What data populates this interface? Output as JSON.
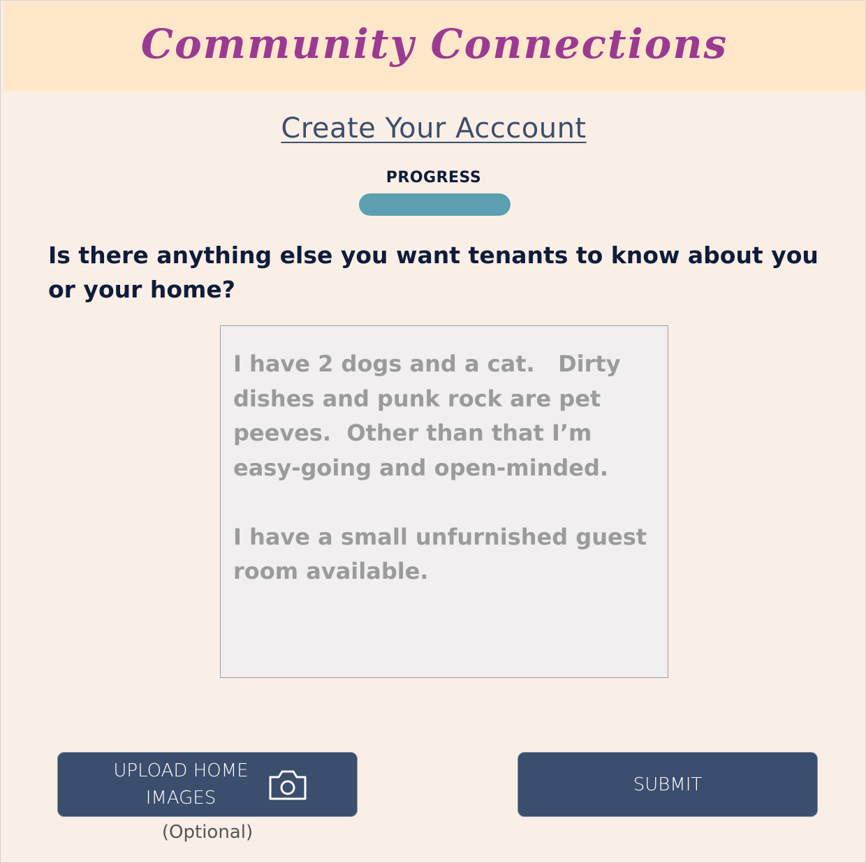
{
  "header": {
    "app_title": "Community Connections"
  },
  "page": {
    "title": "Create Your Acccount"
  },
  "progress": {
    "label": "PROGRESS",
    "value": 1.0
  },
  "form": {
    "question": "Is there anything else you want tenants to know about you or your home?",
    "answer_value": "I have 2 dogs and a cat.   Dirty dishes and punk rock are pet peeves.  Other than that I’m easy-going and open-minded.\n\nI have a small unfurnished guest room available."
  },
  "actions": {
    "upload_label": "UPLOAD HOME IMAGES",
    "upload_icon": "camera-icon",
    "upload_note": "(Optional)",
    "submit_label": "SUBMIT"
  },
  "colors": {
    "header_bg": "#ffe8c9",
    "page_bg": "#f9efe6",
    "brand": "#9b3a93",
    "title": "#3c4e6d",
    "progress_fill": "#5b9fb0",
    "button_bg": "#3c4e6d",
    "placeholder_text": "#9b9b9b"
  }
}
